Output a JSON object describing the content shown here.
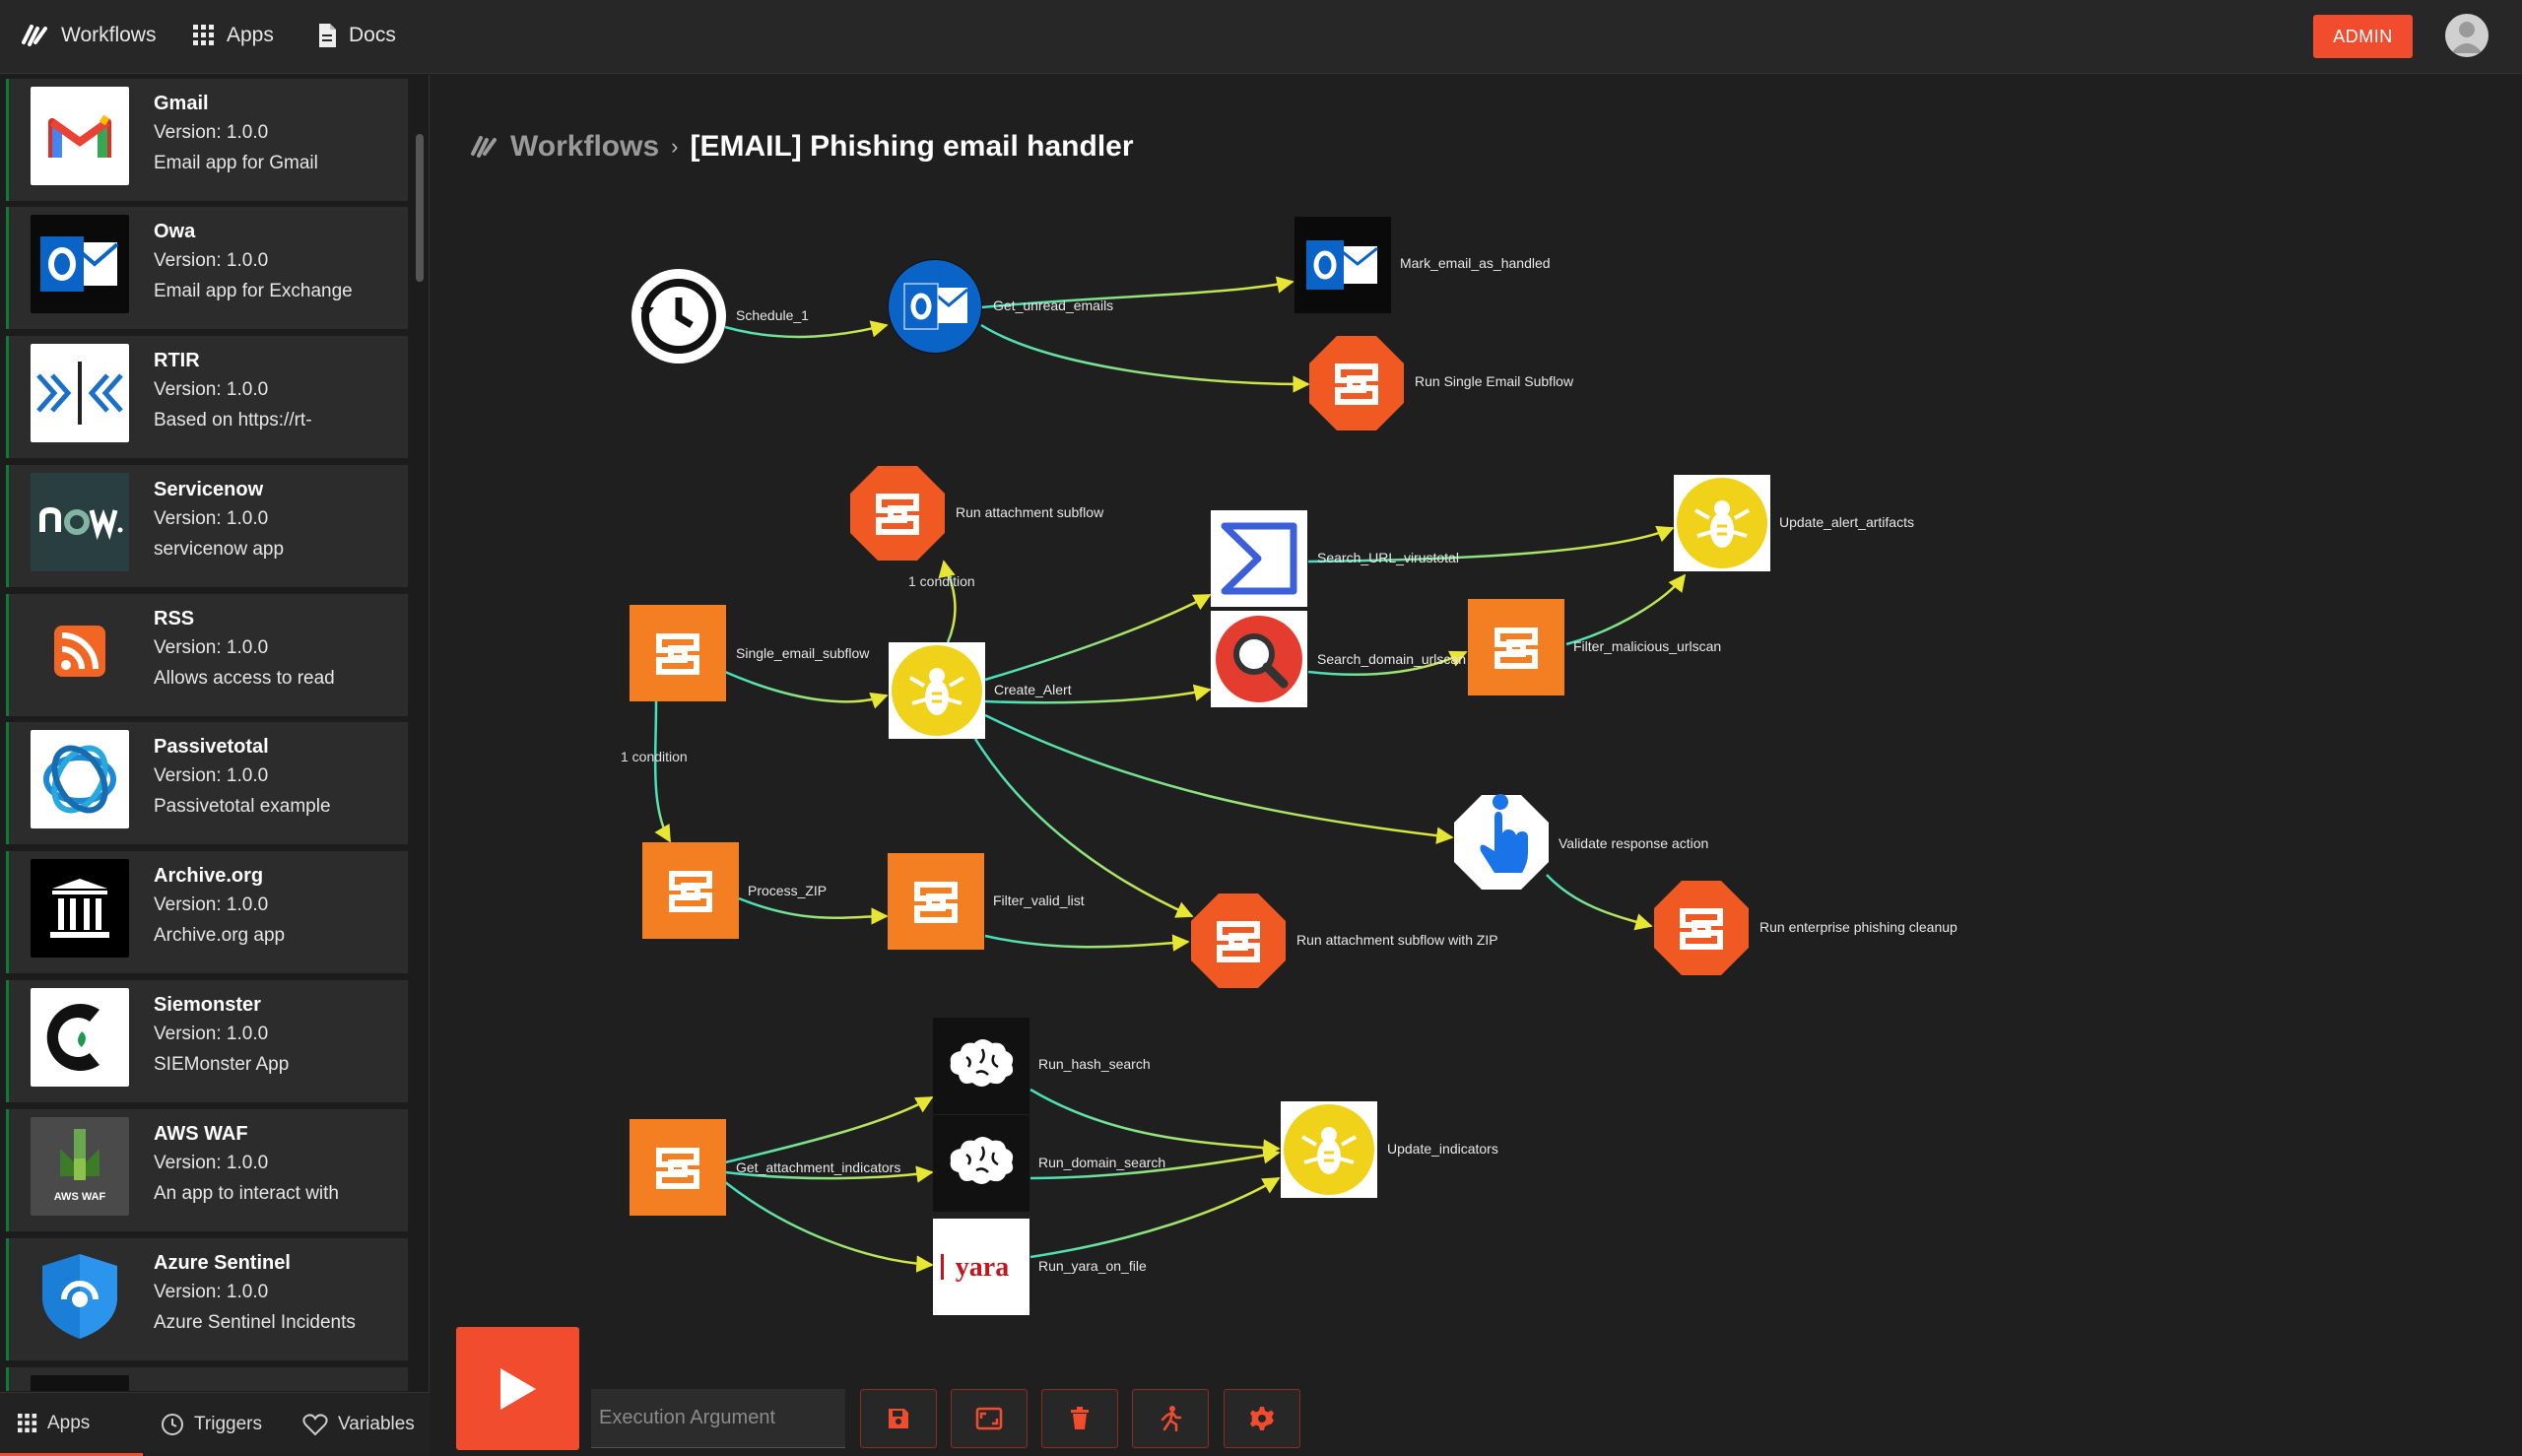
{
  "topbar": {
    "brand_label": "Workflows",
    "apps_label": "Apps",
    "docs_label": "Docs",
    "admin_label": "ADMIN"
  },
  "breadcrumb": {
    "root": "Workflows",
    "separator": "›",
    "title": "[EMAIL] Phishing email handler"
  },
  "sidebar": {
    "apps": [
      {
        "name": "Gmail",
        "version": "Version: 1.0.0",
        "description": "Email app for Gmail",
        "icon": "gmail-icon"
      },
      {
        "name": "Owa",
        "version": "Version: 1.0.0",
        "description": "Email app for Exchange",
        "icon": "outlook-icon"
      },
      {
        "name": "RTIR",
        "version": "Version: 1.0.0",
        "description": "Based on https://rt-",
        "icon": "rtir-icon"
      },
      {
        "name": "Servicenow",
        "version": "Version: 1.0.0",
        "description": "servicenow app",
        "icon": "servicenow-icon"
      },
      {
        "name": "RSS",
        "version": "Version: 1.0.0",
        "description": "Allows access to read",
        "icon": "rss-icon"
      },
      {
        "name": "Passivetotal",
        "version": "Version: 1.0.0",
        "description": "Passivetotal example",
        "icon": "passivetotal-icon"
      },
      {
        "name": "Archive.org",
        "version": "Version: 1.0.0",
        "description": "Archive.org app",
        "icon": "archive-icon"
      },
      {
        "name": "Siemonster",
        "version": "Version: 1.0.0",
        "description": "SIEMonster App",
        "icon": "siemonster-icon"
      },
      {
        "name": "AWS WAF",
        "version": "Version: 1.0.0",
        "description": "An app to interact with",
        "icon": "aws-waf-icon"
      },
      {
        "name": "Azure Sentinel",
        "version": "Version: 1.0.0",
        "description": "Azure Sentinel Incidents",
        "icon": "azure-sentinel-icon"
      }
    ],
    "aws_waf_icon_text": "AWS WAF",
    "tabs": {
      "apps": "Apps",
      "triggers": "Triggers",
      "variables": "Variables"
    }
  },
  "workflow": {
    "nodes": {
      "schedule": "Schedule_1",
      "get_unread": "Get_unread_emails",
      "mark_handled": "Mark_email_as_handled",
      "run_single": "Run Single Email Subflow",
      "run_attachment": "Run attachment subflow",
      "single_email": "Single_email_subflow",
      "create_alert": "Create_Alert",
      "search_url": "Search_URL_virustotal",
      "search_domain": "Search_domain_urlscan",
      "filter_malicious": "Filter_malicious_urlscan",
      "update_alert": "Update_alert_artifacts",
      "validate": "Validate response action",
      "process_zip": "Process_ZIP",
      "filter_valid": "Filter_valid_list",
      "run_attachment_zip": "Run attachment subflow with ZIP",
      "run_enterprise": "Run enterprise phishing cleanup",
      "get_attachment": "Get_attachment_indicators",
      "run_hash": "Run_hash_search",
      "run_domain": "Run_domain_search",
      "run_yara": "Run_yara_on_file",
      "update_indicators": "Update_indicators"
    },
    "edge_labels": {
      "condition_a": "1 condition",
      "condition_b": "1 condition"
    },
    "yara_text": "yara"
  },
  "controls": {
    "execution_placeholder": "Execution Argument",
    "buttons": [
      "save-icon",
      "fit-view-icon",
      "delete-icon",
      "run-user-icon",
      "settings-icon"
    ]
  },
  "colors": {
    "accent": "#f14c2e",
    "edge_cyan": "#3fe0c0",
    "edge_yellow": "#e6e633",
    "shuffle_orange": "#f47e22",
    "thehive_yellow": "#f1d21b"
  }
}
